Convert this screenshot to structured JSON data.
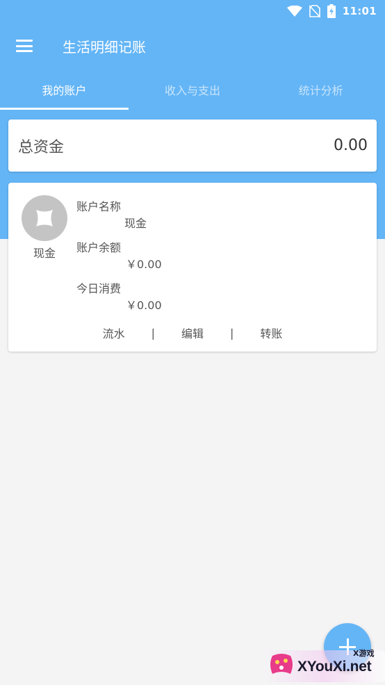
{
  "status_bar": {
    "time": "11:01"
  },
  "app": {
    "title": "生活明细记账"
  },
  "tabs": [
    {
      "label": "我的账户",
      "active": true
    },
    {
      "label": "收入与支出",
      "active": false
    },
    {
      "label": "统计分析",
      "active": false
    }
  ],
  "total": {
    "label": "总资金",
    "value": "0.00"
  },
  "account": {
    "avatar_label": "现金",
    "name_label": "账户名称",
    "name_value": "现金",
    "balance_label": "账户余额",
    "balance_value": "￥0.00",
    "today_label": "今日消费",
    "today_value": "￥0.00",
    "actions": {
      "flow": "流水",
      "edit": "编辑",
      "transfer": "转账",
      "separator": "|"
    }
  },
  "watermark": {
    "text": "XYouXi.net",
    "small": "X游戏"
  },
  "colors": {
    "primary": "#64b5f6",
    "background": "#f4f4f5"
  },
  "icons": [
    "wifi-icon",
    "no-sim-icon",
    "battery-charging-icon",
    "menu-icon",
    "wallet-icon",
    "plus-icon"
  ]
}
